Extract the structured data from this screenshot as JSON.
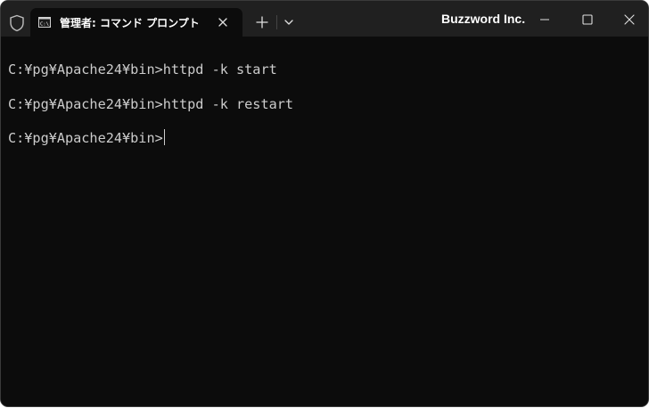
{
  "window": {
    "title": "Buzzword Inc."
  },
  "tabs": [
    {
      "title": "管理者: コマンド プロンプト",
      "icon": "cmd-icon",
      "active": true
    }
  ],
  "terminal": {
    "lines": [
      "C:¥pg¥Apache24¥bin>httpd -k start",
      "C:¥pg¥Apache24¥bin>httpd -k restart",
      "C:¥pg¥Apache24¥bin>"
    ]
  },
  "colors": {
    "background": "#0c0c0c",
    "titlebar": "#202020",
    "text": "#cccccc"
  }
}
